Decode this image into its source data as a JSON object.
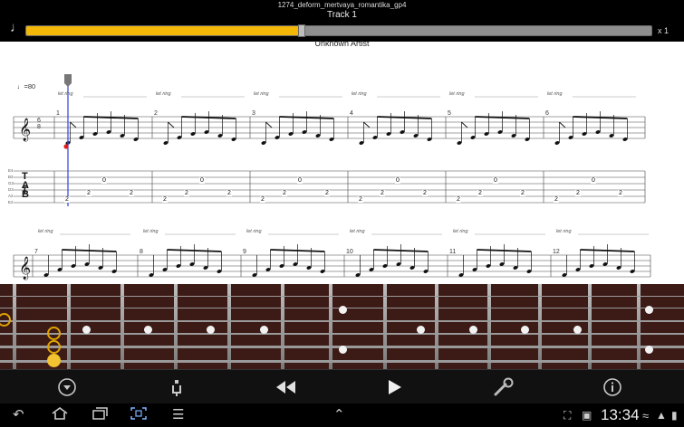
{
  "header": {
    "filename": "1274_deform_mertvaya_romantika_gp4",
    "track": "Track 1",
    "speed": "x 1",
    "progress": 0.44,
    "icon": "music-note-icon"
  },
  "score": {
    "artist": "Unknown Artist",
    "tempo": "♩=80",
    "let_ring": "let ring",
    "time_signature": "6/8",
    "row1_bars": [
      "1",
      "2",
      "3",
      "4",
      "5",
      "6"
    ],
    "row2_bars": [
      "7",
      "8",
      "9",
      "10",
      "11",
      "12"
    ],
    "string_names": [
      "E4",
      "B3",
      "G3",
      "D3",
      "A2",
      "E2"
    ],
    "tab_digits": [
      "0",
      "2",
      "2",
      "2"
    ],
    "cursor_color": "#3f51e0"
  },
  "fretboard": {
    "wood_color": "#3c1a16",
    "highlight_color": "#e0a400"
  },
  "toolbar": {
    "items": [
      "menu-down-icon",
      "tuner-fork-icon",
      "rewind-icon",
      "play-icon",
      "settings-wrench-icon",
      "info-icon"
    ]
  },
  "statusbar": {
    "time": "13:34"
  }
}
